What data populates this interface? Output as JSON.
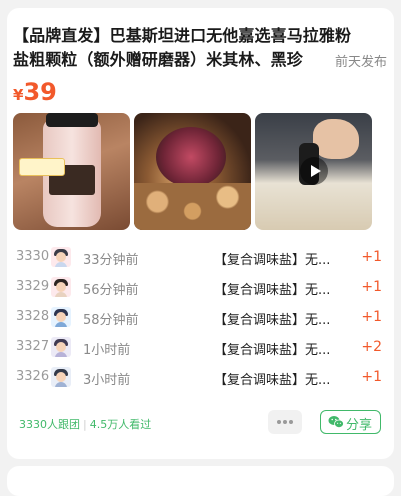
{
  "post": {
    "title_line1": "【品牌直发】巴基斯坦进口无他嘉选喜马拉雅粉",
    "title_line2": "盐粗颗粒（额外赠研磨器）米其林、黑珍",
    "posted": "前天发布",
    "price_currency": "¥",
    "price_value": "39"
  },
  "images": [
    {
      "icon": "salt-jar-image",
      "caption": "Himalayan SALT",
      "stamp": "一罐2280克 相当于4斤多"
    },
    {
      "icon": "nuts-bowl-image"
    },
    {
      "icon": "grinder-video-thumbnail",
      "has_play": true
    }
  ],
  "orders": [
    {
      "id": "3330",
      "time": "33分钟前",
      "product": "【复合调味盐】无...",
      "qty": "+1"
    },
    {
      "id": "3329",
      "time": "56分钟前",
      "product": "【复合调味盐】无...",
      "qty": "+1"
    },
    {
      "id": "3328",
      "time": "58分钟前",
      "product": "【复合调味盐】无...",
      "qty": "+1"
    },
    {
      "id": "3327",
      "time": "1小时前",
      "product": "【复合调味盐】无...",
      "qty": "+2"
    },
    {
      "id": "3326",
      "time": "3小时前",
      "product": "【复合调味盐】无...",
      "qty": "+1"
    }
  ],
  "footer": {
    "followers": "3330人跟团",
    "views": "4.5万人看过",
    "share_label": "分享"
  },
  "colors": {
    "accent": "#f2592b",
    "wechat_green": "#41b96a"
  }
}
